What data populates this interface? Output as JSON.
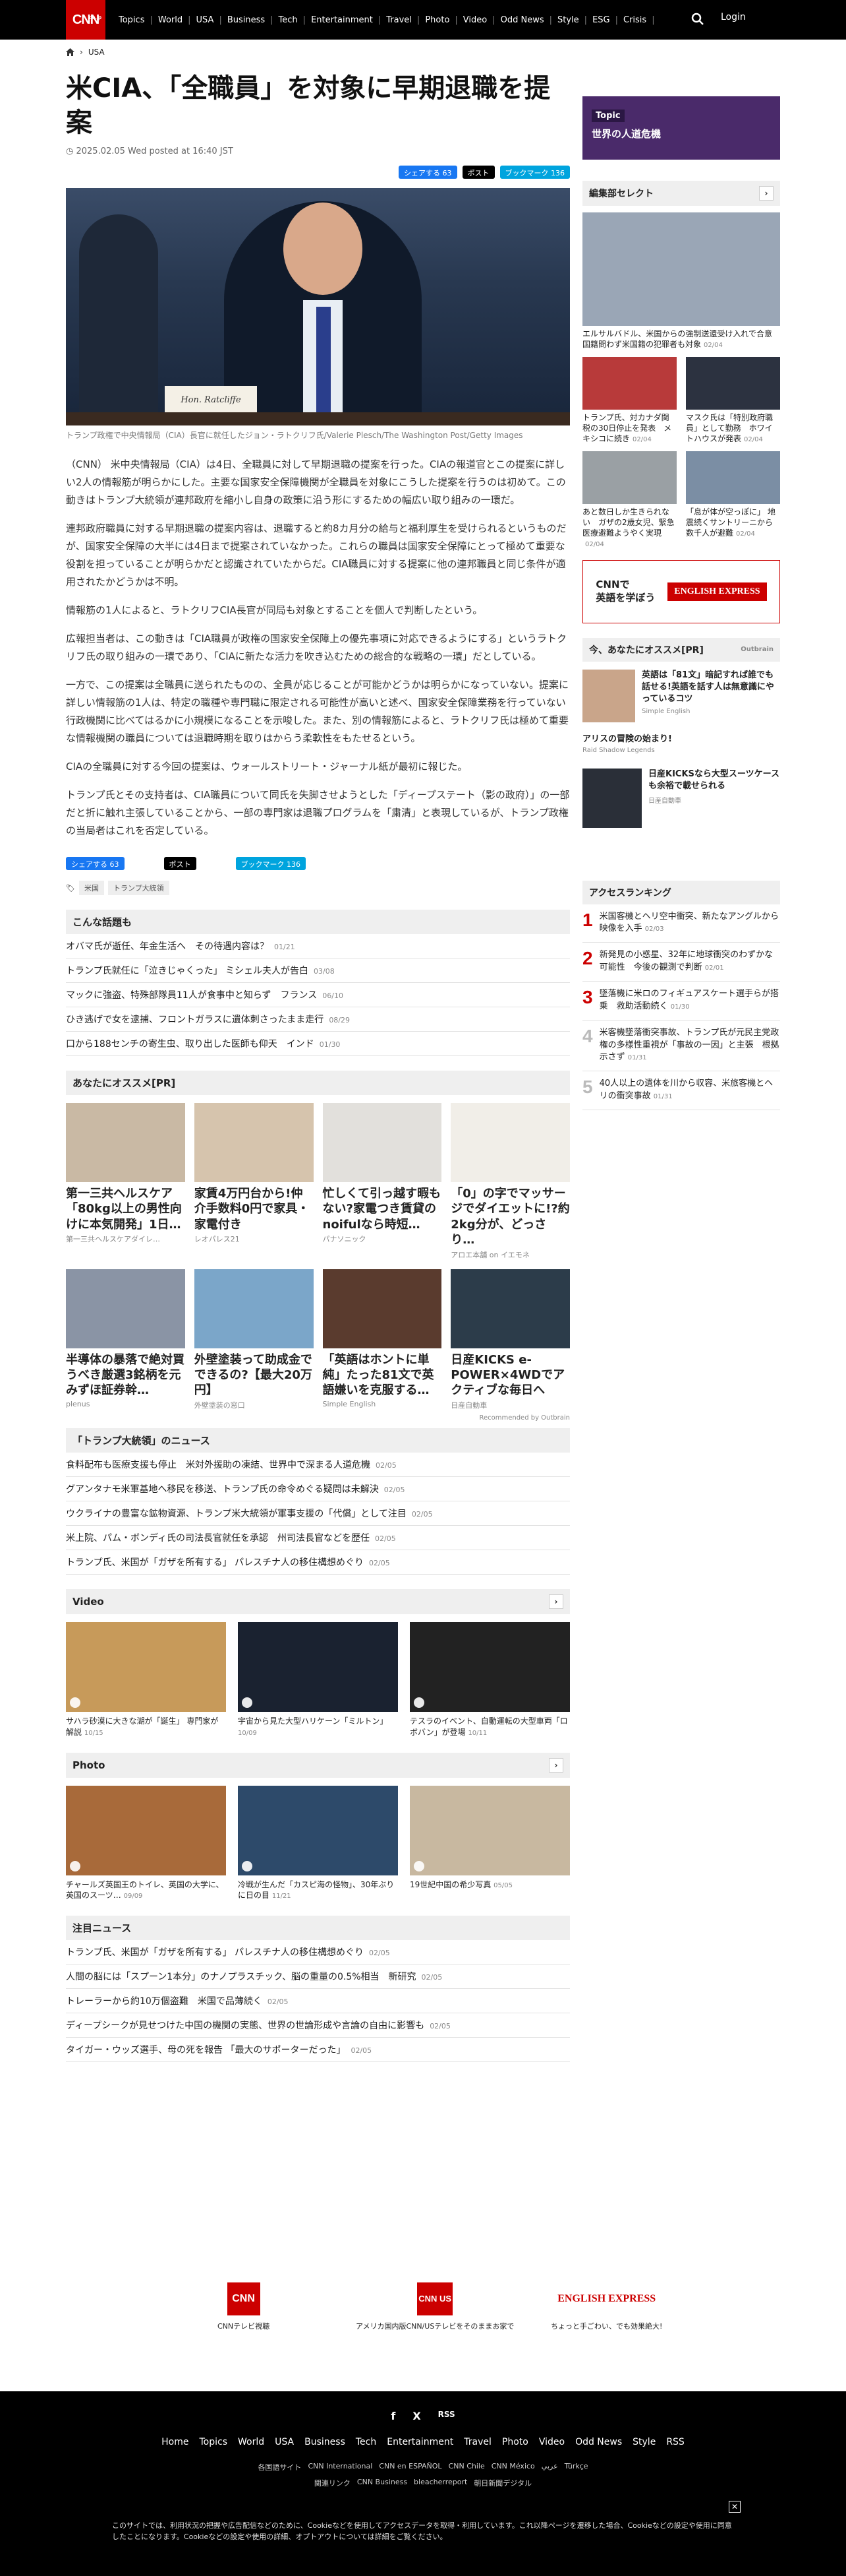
{
  "header": {
    "logo": "CNN",
    "logo_sub": ".co.jp",
    "nav": [
      "Topics",
      "World",
      "USA",
      "Business",
      "Tech",
      "Entertainment",
      "Travel",
      "Photo",
      "Video",
      "Odd News",
      "Style",
      "ESG",
      "Crisis"
    ],
    "login": "Login"
  },
  "breadcrumb": [
    "USA"
  ],
  "article": {
    "title": "米CIA、「全職員」を対象に早期退職を提案",
    "date": "2025.02.05 Wed posted at 16:40 JST",
    "share_fb": "シェアする 63",
    "share_x": "ポスト",
    "share_hb": "ブックマーク 136",
    "image_caption": "トランプ政権で中央情報局（CIA）長官に就任したジョン・ラトクリフ氏/Valerie Plesch/The Washington Post/Getty Images",
    "nameplate": "Hon. Ratcliffe",
    "paragraphs": [
      "（CNN） 米中央情報局（CIA）は4日、全職員に対して早期退職の提案を行った。CIAの報道官とこの提案に詳しい2人の情報筋が明らかにした。主要な国家安全保障機関が全職員を対象にこうした提案を行うのは初めて。この動きはトランプ大統領が連邦政府を縮小し自身の政策に沿う形にするための幅広い取り組みの一環だ。",
      "連邦政府職員に対する早期退職の提案内容は、退職すると約8カ月分の給与と福利厚生を受けられるというものだが、国家安全保障の大半には4日まで提案されていなかった。これらの職員は国家安全保障にとって極めて重要な役割を担っていることが明らかだと認識されていたからだ。CIA職員に対する提案に他の連邦職員と同じ条件が適用されたかどうかは不明。",
      "情報筋の1人によると、ラトクリフCIA長官が同局も対象とすることを個人で判断したという。",
      "広報担当者は、この動きは「CIA職員が政権の国家安全保障上の優先事項に対応できるようにする」というラトクリフ氏の取り組みの一環であり、「CIAに新たな活力を吹き込むための総合的な戦略の一環」だとしている。",
      "一方で、この提案は全職員に送られたものの、全員が応じることが可能かどうかは明らかになっていない。提案に詳しい情報筋の1人は、特定の職種や専門職に限定される可能性が高いと述べ、国家安全保障業務を行っていない行政機関に比べてはるかに小規模になることを示唆した。また、別の情報筋によると、ラトクリフ氏は極めて重要な情報機関の職員については退職時期を取りはからう柔軟性をもたせるという。",
      "CIAの全職員に対する今回の提案は、ウォールストリート・ジャーナル紙が最初に報じた。",
      "トランプ氏とその支持者は、CIA職員について同氏を失脚させようとした「ディープステート（影の政府）」の一部だと折に触れ主張していることから、一部の専門家は退職プログラムを「粛清」と表現しているが、トランプ政権の当局者はこれを否定している。"
    ],
    "tags": [
      "米国",
      "トランプ大統領"
    ]
  },
  "related": {
    "title": "こんな話題も",
    "items": [
      {
        "t": "オバマ氏が逝任、年金生活へ　その待遇内容は？",
        "d": "01/21"
      },
      {
        "t": "トランプ氏就任に「泣きじゃくった」 ミシェル夫人が告白",
        "d": "03/08"
      },
      {
        "t": "マックに強盗、特殊部隊員11人が食事中と知らず　フランス",
        "d": "06/10"
      },
      {
        "t": "ひき逃げで女を逮捕、フロントガラスに遺体刺さったまま走行",
        "d": "08/29"
      },
      {
        "t": "口から188センチの寄生虫、取り出した医師も仰天　インド",
        "d": "01/30"
      }
    ]
  },
  "recommend": {
    "title": "あなたにオススメ[PR]",
    "cards": [
      {
        "t": "第一三共ヘルスケア「80kg以上の男性向けに本気開発」1日…",
        "s": "第一三共ヘルスケアダイレ…",
        "c": "#c9b9a4"
      },
      {
        "t": "家賃4万円台から!仲介手数料0円で家具・家電付き",
        "s": "レオパレス21",
        "c": "#d6c4ad"
      },
      {
        "t": "忙しくて引っ越す暇もない?家電つき賃貸のnoifulなら時短…",
        "s": "パナソニック",
        "c": "#e2e0dc"
      },
      {
        "t": "「0」の字でマッサージでダイエットに!?約2kg分が、どっさり…",
        "s": "アロエ本舗 on イエモネ",
        "c": "#f1eee8"
      },
      {
        "t": "半導体の暴落で絶対買うべき厳選3銘柄を元みずほ証券幹…",
        "s": "plenus",
        "c": "#8a94a5"
      },
      {
        "t": "外壁塗装って助成金でできるの?【最大20万円】",
        "s": "外壁塗装の窓口",
        "c": "#7ba6c9"
      },
      {
        "t": "「英語はホントに単純」たった81文で英語嫌いを克服する…",
        "s": "Simple English",
        "c": "#5a3b2e"
      },
      {
        "t": "日産KICKS e-POWER×4WDでアクティブな毎日へ",
        "s": "日産自動車",
        "c": "#2c3c4a"
      }
    ],
    "outbrain": "Recommended by Outbrain"
  },
  "series": {
    "title": "「トランプ大統領」のニュース",
    "items": [
      {
        "t": "食料配布も医療支援も停止　米対外援助の凍結、世界中で深まる人道危機",
        "d": "02/05"
      },
      {
        "t": "グアンタナモ米軍基地へ移民を移送、トランプ氏の命令めぐる疑問は未解決",
        "d": "02/05"
      },
      {
        "t": "ウクライナの豊富な鉱物資源、トランプ米大統領が軍事支援の「代償」として注目",
        "d": "02/05"
      },
      {
        "t": "米上院、パム・ボンディ氏の司法長官就任を承認　州司法長官などを歴任",
        "d": "02/05"
      },
      {
        "t": "トランプ氏、米国が「ガザを所有する」 パレスチナ人の移住構想めぐり",
        "d": "02/05"
      }
    ]
  },
  "video": {
    "title": "Video",
    "items": [
      {
        "t": "サハラ砂漠に大きな湖が「誕生」 専門家が解説",
        "d": "10/15",
        "c": "#c79a5a"
      },
      {
        "t": "宇宙から見た大型ハリケーン「ミルトン」",
        "d": "10/09",
        "c": "#1a2230"
      },
      {
        "t": "テスラのイベント、自動運転の大型車両「ロボバン」が登場",
        "d": "10/11",
        "c": "#222"
      }
    ]
  },
  "photo": {
    "title": "Photo",
    "items": [
      {
        "t": "チャールズ英国王のトイレ、英国の大学に、英国のスーツ…",
        "d": "09/09",
        "c": "#a86a3a"
      },
      {
        "t": "冷戦が生んだ「カスピ海の怪物」、30年ぶりに日の目",
        "d": "11/21",
        "c": "#2d4a6a"
      },
      {
        "t": "19世紀中国の希少写真",
        "d": "05/05",
        "c": "#c8b8a0"
      }
    ]
  },
  "attention": {
    "title": "注目ニュース",
    "items": [
      {
        "t": "トランプ氏、米国が「ガザを所有する」 パレスチナ人の移住構想めぐり",
        "d": "02/05"
      },
      {
        "t": "人間の脳には「スプーン1本分」のナノプラスチック、脳の重量の0.5%相当　新研究",
        "d": "02/05"
      },
      {
        "t": "トレーラーから約10万個盗難　米国で品薄続く",
        "d": "02/05"
      },
      {
        "t": "ディープシークが見せつけた中国の機関の実態、世界の世論形成や言論の自由に影響も",
        "d": "02/05"
      },
      {
        "t": "タイガー・ウッズ選手、母の死を報告 「最大のサポーターだった」",
        "d": "02/05"
      }
    ]
  },
  "sidebar": {
    "topic_label": "Topic",
    "topic_title": "世界の人道危機",
    "editor_title": "編集部セレクト",
    "editor_items": [
      {
        "t": "エルサルバドル、米国からの強制送還受け入れで合意　国籍問わず米国籍の犯罪者も対象",
        "d": "02/04",
        "c": "#9aa6b6"
      },
      {
        "t": "トランプ氏、対カナダ関税の30日停止を発表　メキシコに続き",
        "d": "02/04",
        "c": "#b83a3a"
      },
      {
        "t": "マスク氏は「特別政府職員」として勤務　ホワイトハウスが発表",
        "d": "02/04",
        "c": "#2c3240"
      },
      {
        "t": "あと数日しか生きられない　ガザの2歳女児、緊急医療避難ようやく実現",
        "d": "02/04",
        "c": "#9aa0a4"
      },
      {
        "t": "「息が体が空っぽに」 地震続くサントリーニから数千人が避難",
        "d": "02/04",
        "c": "#7b8ea4"
      }
    ],
    "english_ad_line1": "CNNで",
    "english_ad_line2": "英語を学ぼう",
    "english_ad_brand": "ENGLISH EXPRESS",
    "pr_title": "今、あなたにオススメ[PR]",
    "pr_items": [
      {
        "t": "英語は「81文」暗記すれば誰でも話せる!英語を話す人は無意識にやっているコツ",
        "s": "Simple English"
      },
      {
        "t": "アリスの冒険の始まり!",
        "s": "Raid Shadow Legends"
      },
      {
        "t": "日産KICKSなら大型スーツケースも余裕で載せられる",
        "s": "日産自動車"
      }
    ],
    "ranking_title": "アクセスランキング",
    "ranking": [
      {
        "n": "1",
        "t": "米国客機とヘリ空中衝突、新たなアングルから映像を入手",
        "d": "02/03"
      },
      {
        "t": "新発見の小惑星、32年に地球衝突のわずかな可能性　今後の観測で判断",
        "n": "2",
        "d": "02/01"
      },
      {
        "n": "3",
        "t": "墜落機に米ロのフィギュアスケート選手らが搭乗　救助活動続く",
        "d": "01/30"
      },
      {
        "n": "4",
        "t": "米客機墜落衝突事故、トランプ氏が元民主党政権の多様性重視が「事故の一因」と主張　根拠示さず",
        "d": "01/31"
      },
      {
        "n": "5",
        "t": "40人以上の遺体を川から収容、米旅客機とヘリの衝突事故",
        "d": "01/31"
      }
    ]
  },
  "footer": {
    "brands": [
      {
        "logo": "CNN",
        "label": "CNNテレビ視聴"
      },
      {
        "logo": "CNN US",
        "label": "アメリカ国内版CNN/USテレビをそのままお家で"
      },
      {
        "logo": "ENGLISH EXPRESS",
        "label": "ちょっと手ごわい、でも効果絶大!"
      }
    ],
    "social": [
      "f",
      "X",
      "RSS"
    ],
    "nav": [
      "Home",
      "Topics",
      "World",
      "USA",
      "Business",
      "Tech",
      "Entertainment",
      "Travel",
      "Photo",
      "Video",
      "Odd News",
      "Style",
      "RSS"
    ],
    "sub": [
      "各国語サイト",
      "CNN International",
      "CNN en ESPAÑOL",
      "CNN Chile",
      "CNN México",
      "عربي",
      "Türkçe"
    ],
    "sub2": [
      "関連リンク",
      "CNN Business",
      "bleacherreport",
      "朝日新聞デジタル"
    ],
    "cookie": "このサイトでは、利用状況の把握や広告配信などのために、Cookieなどを使用してアクセスデータを取得・利用しています。これ以降ページを遷移した場合、Cookieなどの設定や使用に同意したことになります。Cookieなどの設定や使用の詳細、オプトアウトについては詳細をご覧ください。"
  }
}
